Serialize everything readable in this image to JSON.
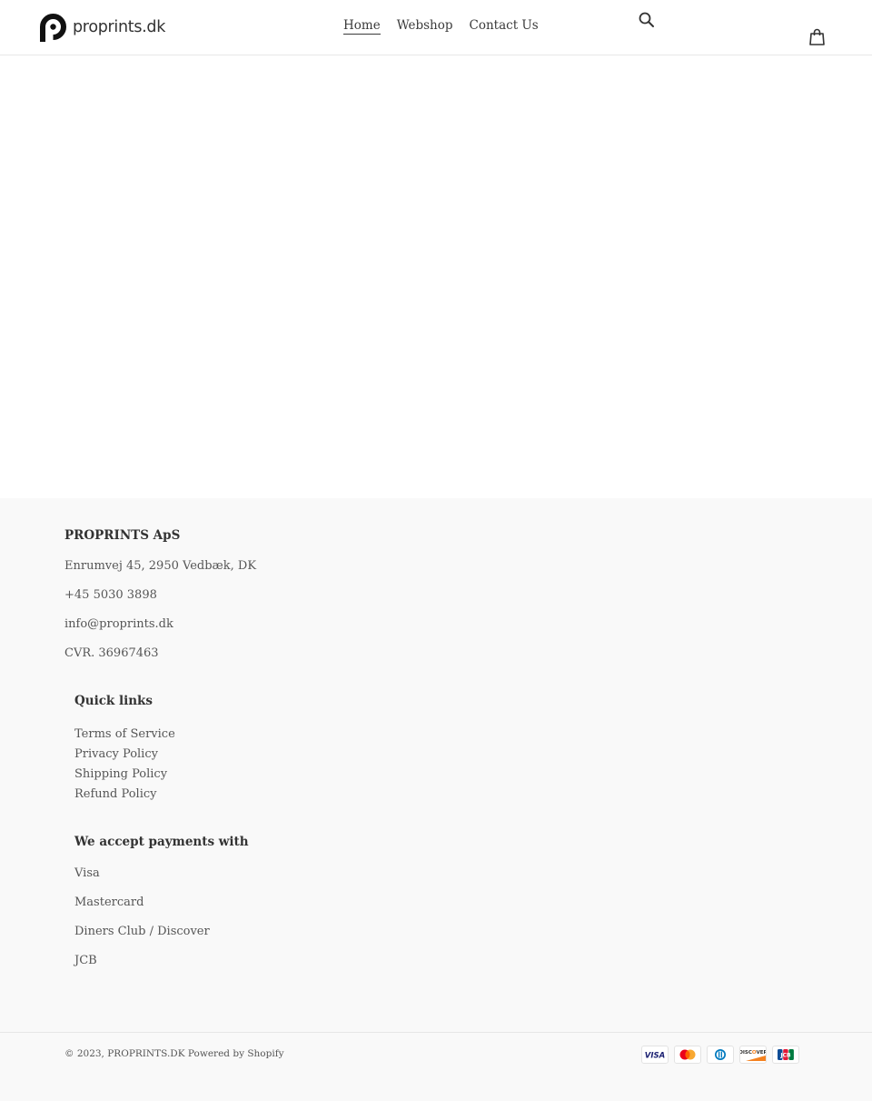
{
  "header": {
    "logo_text": "proprints.dk",
    "nav": [
      {
        "label": "Home",
        "active": true
      },
      {
        "label": "Webshop",
        "active": false
      },
      {
        "label": "Contact Us",
        "active": false
      }
    ],
    "search_icon": "search-icon",
    "cart_icon": "shopping-bag-icon"
  },
  "footer": {
    "company": {
      "title": "PROPRINTS ApS",
      "address": "Enrumvej 45, 2950 Vedbæk, DK",
      "phone": "+45 5030 3898",
      "email": "info@proprints.dk",
      "cvr": "CVR. 36967463"
    },
    "quick_links": {
      "title": "Quick links",
      "items": [
        "Terms of Service",
        "Privacy Policy",
        "Shipping Policy",
        "Refund Policy"
      ]
    },
    "payments": {
      "title": "We accept payments with",
      "items": [
        "Visa",
        "Mastercard",
        "Diners Club / Discover",
        "JCB"
      ]
    },
    "copyright": "© 2023, PROPRINTS.DK",
    "powered_by": "Powered by Shopify",
    "payment_icons": [
      "visa-icon",
      "mastercard-icon",
      "diners-club-icon",
      "discover-icon",
      "jcb-icon"
    ],
    "colors": {
      "visa": "#1a1f71",
      "mastercard_red": "#eb001b",
      "mastercard_orange": "#f79e1b",
      "diners": "#0079be",
      "discover": "#f58220"
    }
  }
}
